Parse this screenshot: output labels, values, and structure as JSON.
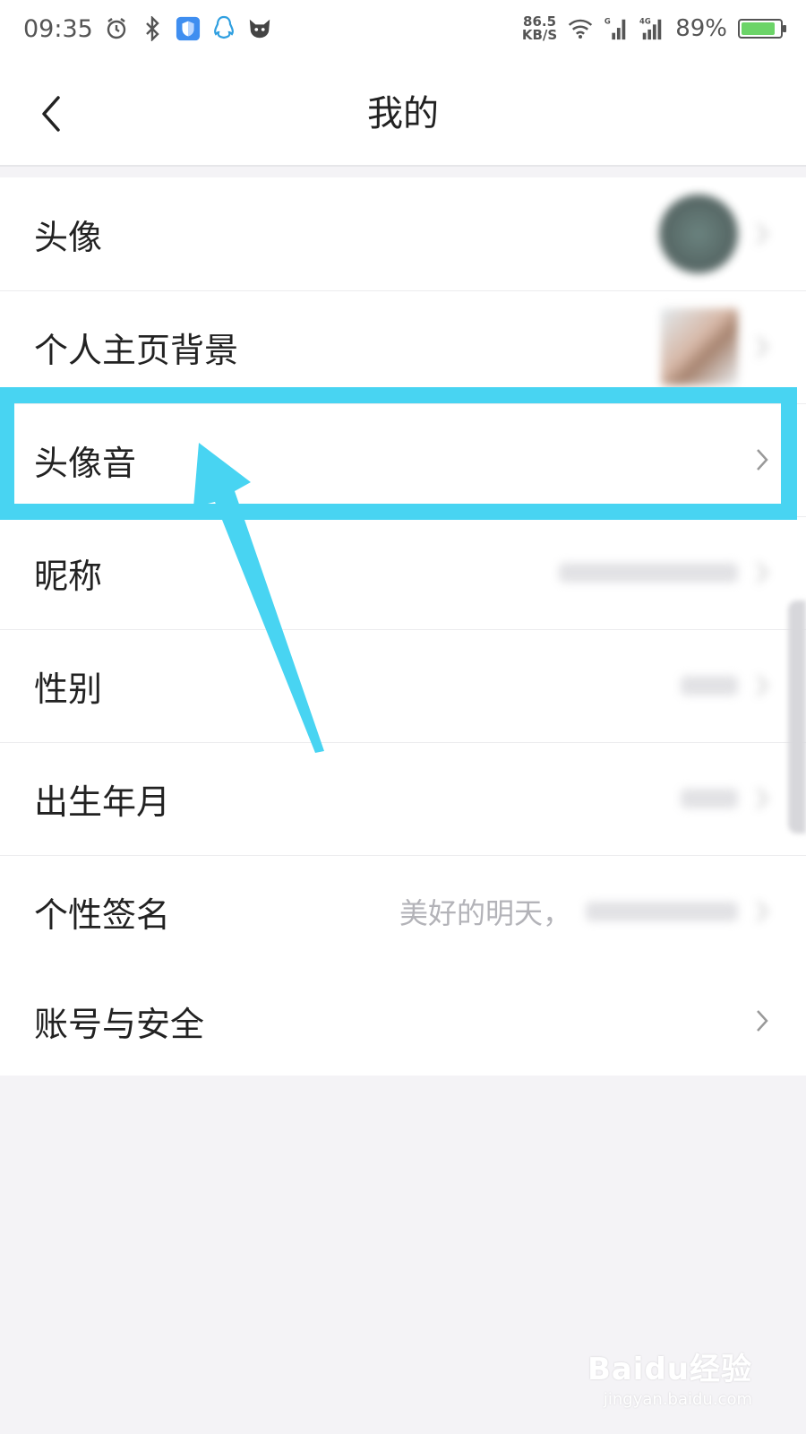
{
  "status_bar": {
    "time": "09:35",
    "netspeed_value": "86.5",
    "netspeed_unit": "KB/S",
    "battery_percent": "89%",
    "battery_level": 0.89
  },
  "header": {
    "title": "我的"
  },
  "profile_rows": [
    {
      "label": "头像"
    },
    {
      "label": "个人主页背景"
    },
    {
      "label": "头像音"
    },
    {
      "label": "昵称"
    },
    {
      "label": "性别"
    },
    {
      "label": "出生年月"
    },
    {
      "label": "个性签名",
      "value": "美好的明天，"
    }
  ],
  "account_rows": [
    {
      "label": "账号与安全"
    }
  ],
  "watermark": {
    "main": "Baidu经验",
    "sub": "jingyan.baidu.com"
  },
  "colors": {
    "highlight": "#48d4f2",
    "battery_fill": "#6cd468"
  }
}
